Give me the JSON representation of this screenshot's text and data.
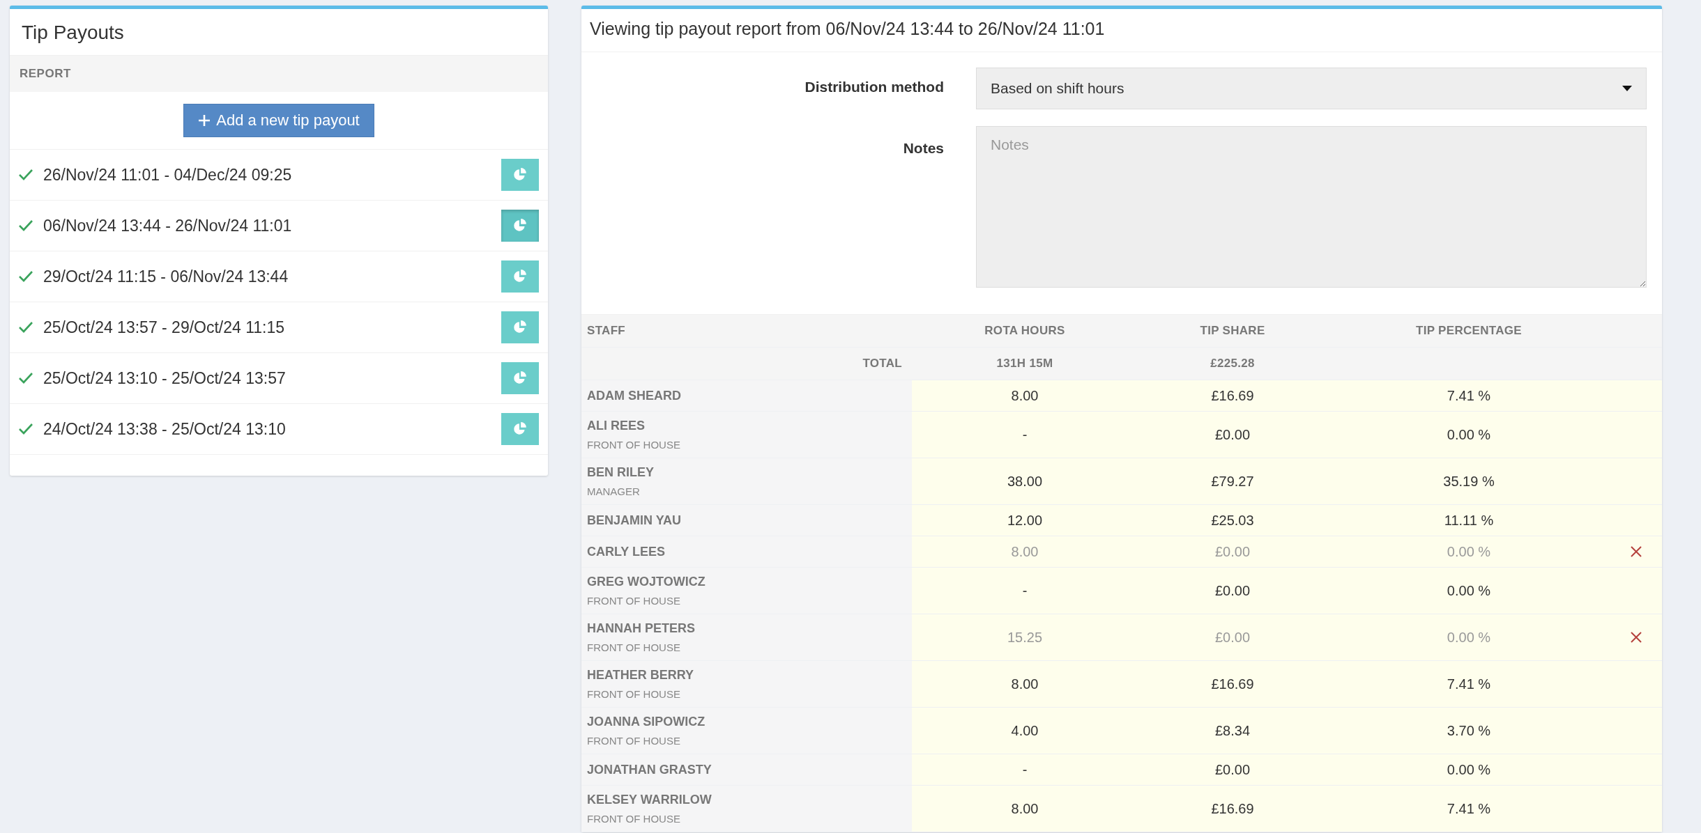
{
  "payouts_panel": {
    "title": "Tip Payouts",
    "column_header": "REPORT",
    "add_button": "Add a new tip payout",
    "items": [
      {
        "range": "26/Nov/24 11:01 - 04/Dec/24 09:25",
        "completed": true,
        "selected": false
      },
      {
        "range": "06/Nov/24 13:44 - 26/Nov/24 11:01",
        "completed": true,
        "selected": true
      },
      {
        "range": "29/Oct/24 11:15 - 06/Nov/24 13:44",
        "completed": true,
        "selected": false
      },
      {
        "range": "25/Oct/24 13:57 - 29/Oct/24 11:15",
        "completed": true,
        "selected": false
      },
      {
        "range": "25/Oct/24 13:10 - 25/Oct/24 13:57",
        "completed": true,
        "selected": false
      },
      {
        "range": "24/Oct/24 13:38 - 25/Oct/24 13:10",
        "completed": true,
        "selected": false
      }
    ]
  },
  "report_panel": {
    "title": "Viewing tip payout report from 06/Nov/24 13:44 to 26/Nov/24 11:01",
    "distribution_method": {
      "label": "Distribution method",
      "value": "Based on shift hours"
    },
    "notes": {
      "label": "Notes",
      "placeholder": "Notes"
    },
    "table": {
      "columns": [
        "STAFF",
        "ROTA HOURS",
        "TIP SHARE",
        "TIP PERCENTAGE"
      ],
      "total": {
        "label": "TOTAL",
        "rota_hours": "131H 15M",
        "tip_share": "£225.28"
      },
      "rows": [
        {
          "name": "ADAM SHEARD",
          "role": null,
          "rota_hours": "8.00",
          "tip_share": "£16.69",
          "tip_percentage": "7.41 %",
          "excluded": false
        },
        {
          "name": "ALI REES",
          "role": "FRONT OF HOUSE",
          "rota_hours": "-",
          "tip_share": "£0.00",
          "tip_percentage": "0.00 %",
          "excluded": false
        },
        {
          "name": "BEN RILEY",
          "role": "MANAGER",
          "rota_hours": "38.00",
          "tip_share": "£79.27",
          "tip_percentage": "35.19 %",
          "excluded": false
        },
        {
          "name": "BENJAMIN YAU",
          "role": null,
          "rota_hours": "12.00",
          "tip_share": "£25.03",
          "tip_percentage": "11.11 %",
          "excluded": false
        },
        {
          "name": "CARLY LEES",
          "role": null,
          "rota_hours": "8.00",
          "tip_share": "£0.00",
          "tip_percentage": "0.00 %",
          "excluded": true
        },
        {
          "name": "GREG WOJTOWICZ",
          "role": "FRONT OF HOUSE",
          "rota_hours": "-",
          "tip_share": "£0.00",
          "tip_percentage": "0.00 %",
          "excluded": false
        },
        {
          "name": "HANNAH PETERS",
          "role": "FRONT OF HOUSE",
          "rota_hours": "15.25",
          "tip_share": "£0.00",
          "tip_percentage": "0.00 %",
          "excluded": true
        },
        {
          "name": "HEATHER BERRY",
          "role": "FRONT OF HOUSE",
          "rota_hours": "8.00",
          "tip_share": "£16.69",
          "tip_percentage": "7.41 %",
          "excluded": false
        },
        {
          "name": "JOANNA SIPOWICZ",
          "role": "FRONT OF HOUSE",
          "rota_hours": "4.00",
          "tip_share": "£8.34",
          "tip_percentage": "3.70 %",
          "excluded": false
        },
        {
          "name": "JONATHAN GRASTY",
          "role": null,
          "rota_hours": "-",
          "tip_share": "£0.00",
          "tip_percentage": "0.00 %",
          "excluded": false
        },
        {
          "name": "KELSEY WARRILOW",
          "role": "FRONT OF HOUSE",
          "rota_hours": "8.00",
          "tip_share": "£16.69",
          "tip_percentage": "7.41 %",
          "excluded": false
        }
      ]
    }
  }
}
